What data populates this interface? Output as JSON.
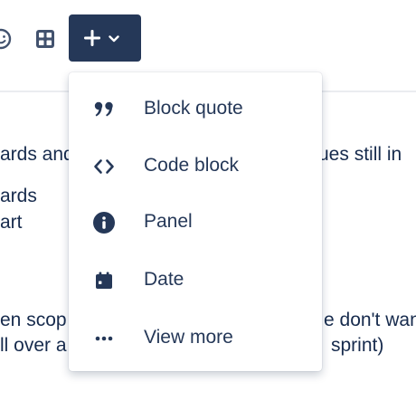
{
  "toolbar": {
    "emoji_icon": "emoji-icon",
    "table_icon": "table-icon",
    "insert_button": {
      "icon": "plus-icon",
      "dropdown_icon": "chevron-down-icon"
    }
  },
  "editor": {
    "lines": [
      "ards and",
      "ues still in",
      "ards",
      "art",
      "en scop",
      "e don't wan",
      "ll over a",
      "sprint)"
    ]
  },
  "insert_menu": {
    "items": [
      {
        "label": "Block quote",
        "icon": "quote-icon"
      },
      {
        "label": "Code block",
        "icon": "code-icon"
      },
      {
        "label": "Panel",
        "icon": "info-icon"
      },
      {
        "label": "Date",
        "icon": "calendar-icon"
      },
      {
        "label": "View more",
        "icon": "more-icon"
      }
    ]
  },
  "colors": {
    "primary_dark": "#253858",
    "text": "#172B4D",
    "icon_muted": "#42526E",
    "divider": "#EBECF0"
  }
}
